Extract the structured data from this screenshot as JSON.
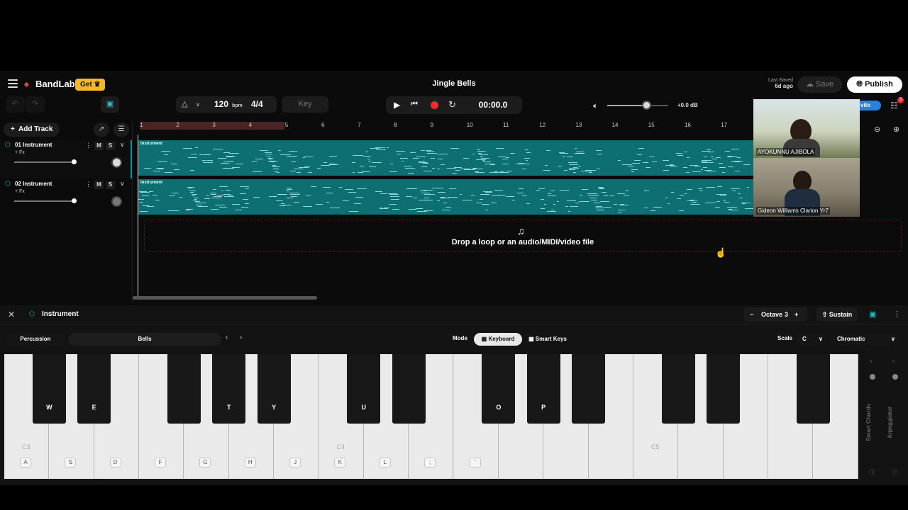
{
  "app": {
    "brand": "BandLab",
    "get_label": "Get",
    "title": "Jingle Bells",
    "last_saved_label": "Last Saved",
    "last_saved_value": "6d ago",
    "save_label": "Save",
    "publish_label": "Publish",
    "invite_label": "vite",
    "gift_badge": "3"
  },
  "toolbar": {
    "bpm_value": "120",
    "bpm_unit": "bpm",
    "time_signature": "4/4",
    "key_label": "Key",
    "time": "00:00.0",
    "volume_db": "+0.0 dB"
  },
  "tracks_panel": {
    "add_track_label": "Add Track",
    "tracks": [
      {
        "name": "01  Instrument",
        "fx": "+ Fx",
        "mute": "M",
        "solo": "S",
        "lane_label": "Instrument",
        "volume_fraction": 0.86
      },
      {
        "name": "02  Instrument",
        "fx": "+ Fx",
        "mute": "M",
        "solo": "S",
        "lane_label": "Instrument",
        "volume_fraction": 0.86
      }
    ]
  },
  "ruler": {
    "bars": [
      "1",
      "2",
      "3",
      "4",
      "5",
      "6",
      "7",
      "8",
      "9",
      "10",
      "11",
      "12",
      "13",
      "14",
      "15",
      "16",
      "17"
    ]
  },
  "dropzone": {
    "text": "Drop a loop or an audio/MIDI/video file"
  },
  "video_call": {
    "participants": [
      "AYOKUNNU AJIBOLA",
      "Gideon Williams Clarion Yr7"
    ]
  },
  "instrument_panel": {
    "title": "Instrument",
    "octave_label": "Octave",
    "octave_value": "3",
    "sustain_label": "Sustain",
    "category": "Percussion",
    "preset": "Bells",
    "mode_label": "Mode",
    "mode_keyboard": "Keyboard",
    "mode_smart_keys": "Smart Keys",
    "scale_label": "Scale",
    "scale_root": "C",
    "scale_type": "Chromatic",
    "side_smart_chords": "Smart Chords",
    "side_arpeggiator": "Arpeggiator"
  },
  "keyboard": {
    "white_keys": [
      "A",
      "S",
      "D",
      "F",
      "G",
      "H",
      "J",
      "K",
      "L",
      ";",
      "'",
      "",
      "",
      "",
      "",
      "",
      "",
      "",
      ""
    ],
    "black_keys": [
      "W",
      "E",
      "",
      "T",
      "Y",
      "U",
      "",
      "O",
      "P",
      "",
      "",
      "",
      "",
      "",
      "",
      ""
    ],
    "octave_labels": [
      "C3",
      "C4",
      "C5"
    ]
  },
  "colors": {
    "accent": "#0d6f72",
    "record": "#ee2c2c",
    "get": "#f5b928",
    "brand": "#f24a3c"
  }
}
